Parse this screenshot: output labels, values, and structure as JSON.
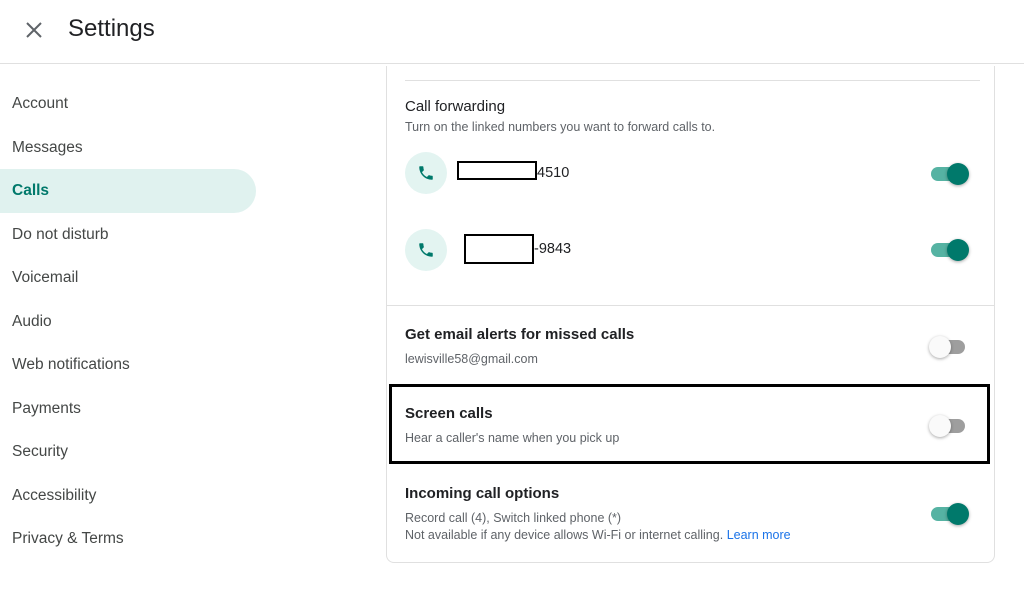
{
  "header": {
    "title": "Settings",
    "close_icon": "close-icon"
  },
  "sidebar": {
    "items": [
      {
        "label": "Account"
      },
      {
        "label": "Messages"
      },
      {
        "label": "Calls",
        "active": true
      },
      {
        "label": "Do not disturb"
      },
      {
        "label": "Voicemail"
      },
      {
        "label": "Audio"
      },
      {
        "label": "Web notifications"
      },
      {
        "label": "Payments"
      },
      {
        "label": "Security"
      },
      {
        "label": "Accessibility"
      },
      {
        "label": "Privacy & Terms"
      }
    ]
  },
  "call_forwarding": {
    "title": "Call forwarding",
    "subtitle": "Turn on the linked numbers you want to forward calls to.",
    "numbers": [
      {
        "suffix": "4510",
        "enabled": true,
        "icon": "phone-icon"
      },
      {
        "suffix": "-9843",
        "enabled": true,
        "icon": "phone-icon"
      }
    ]
  },
  "email_alerts": {
    "title": "Get email alerts for missed calls",
    "email": "lewisville58@gmail.com",
    "enabled": false
  },
  "screen_calls": {
    "title": "Screen calls",
    "subtitle": "Hear a caller's name when you pick up",
    "enabled": false
  },
  "incoming_options": {
    "title": "Incoming call options",
    "line1": "Record call (4), Switch linked phone (*)",
    "line2": "Not available if any device allows Wi-Fi or internet calling.",
    "link": "Learn more",
    "enabled": true
  },
  "colors": {
    "accent": "#00796b",
    "accent_light": "#e0f2ef",
    "link": "#1a73e8"
  }
}
